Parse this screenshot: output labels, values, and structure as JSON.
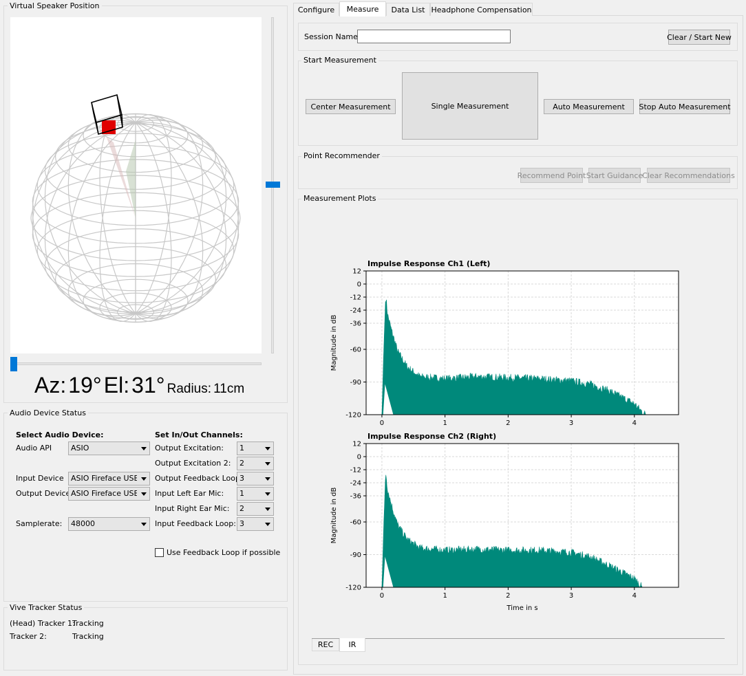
{
  "speaker": {
    "title": "Virtual Speaker Position",
    "az_label": "Az:",
    "az_value": "19°",
    "el_label": "El:",
    "el_value": "31°",
    "radius_label": "Radius:",
    "radius_value": "11cm"
  },
  "audio": {
    "title": "Audio Device Status",
    "select_heading": "Select Audio Device:",
    "channels_heading": "Set In/Out Channels:",
    "api_label": "Audio API",
    "api_value": "ASIO",
    "input_label": "Input Device",
    "input_value": "ASIO Fireface USB (",
    "output_label": "Output Device",
    "output_value": "ASIO Fireface USB (",
    "samplerate_label": "Samplerate:",
    "samplerate_value": "48000",
    "channels": [
      {
        "label": "Output Excitation:",
        "value": "1"
      },
      {
        "label": "Output Excitation 2:",
        "value": "2"
      },
      {
        "label": "Output Feedback Loop:",
        "value": "3"
      },
      {
        "label": "Input Left Ear Mic:",
        "value": "1"
      },
      {
        "label": "Input Right Ear Mic:",
        "value": "2"
      },
      {
        "label": "Input Feedback Loop:",
        "value": "3"
      }
    ],
    "feedback_checkbox": "Use Feedback Loop if possible"
  },
  "vive": {
    "title": "Vive Tracker Status",
    "tracker1_label": "(Head) Tracker 1:",
    "tracker1_status": "Tracking",
    "tracker2_label": "Tracker 2:",
    "tracker2_status": "Tracking"
  },
  "tabs": [
    "Configure",
    "Measure",
    "Data List",
    "Headphone Compensation"
  ],
  "active_tab": "Measure",
  "session": {
    "label": "Session Name:",
    "value": "",
    "clear_button": "Clear / Start New"
  },
  "start_measurement": {
    "title": "Start Measurement",
    "center": "Center Measurement",
    "single": "Single Measurement",
    "auto": "Auto Measurement",
    "stop": "Stop Auto Measurement"
  },
  "recommender": {
    "title": "Point Recommender",
    "recommend": "Recommend Point",
    "guidance": "Start Guidance",
    "clear": "Clear Recommendations"
  },
  "plots": {
    "title": "Measurement Plots",
    "bottom_tabs": [
      "REC",
      "IR"
    ],
    "active_bottom_tab": "IR"
  },
  "colors": {
    "trace": "#00897b",
    "speaker": "#e00000",
    "slider": "#0078d7"
  },
  "chart_data": [
    {
      "type": "area",
      "title": "Impulse Response Ch1 (Left)",
      "xlabel": "",
      "ylabel": "Magnitude in dB",
      "xlim": [
        -0.25,
        4.7
      ],
      "ylim": [
        -120,
        12
      ],
      "xticks": [
        0,
        1,
        2,
        3,
        4
      ],
      "yticks": [
        12,
        0,
        -12,
        -24,
        -36,
        -60,
        -90,
        -120
      ],
      "grid": true,
      "envelope": {
        "x": [
          0,
          0.03,
          0.06,
          0.09,
          0.15,
          0.25,
          0.4,
          0.6,
          1.0,
          1.5,
          2.0,
          2.5,
          3.0,
          3.3,
          3.6,
          3.8,
          4.0,
          4.1,
          4.18
        ],
        "y": [
          -120,
          -60,
          -10,
          -28,
          -42,
          -62,
          -76,
          -85,
          -87,
          -85,
          -86,
          -87,
          -89,
          -92,
          -98,
          -104,
          -110,
          -116,
          -120
        ]
      }
    },
    {
      "type": "area",
      "title": "Impulse Response Ch2 (Right)",
      "xlabel": "Time in s",
      "ylabel": "Magnitude in dB",
      "xlim": [
        -0.25,
        4.7
      ],
      "ylim": [
        -120,
        12
      ],
      "xticks": [
        0,
        1,
        2,
        3,
        4
      ],
      "yticks": [
        12,
        0,
        -12,
        -24,
        -36,
        -60,
        -90,
        -120
      ],
      "grid": true,
      "envelope": {
        "x": [
          0,
          0.03,
          0.06,
          0.09,
          0.15,
          0.25,
          0.4,
          0.6,
          1.0,
          1.5,
          2.0,
          2.5,
          3.0,
          3.3,
          3.6,
          3.8,
          4.0,
          4.08,
          4.12
        ],
        "y": [
          -120,
          -62,
          -14,
          -30,
          -44,
          -63,
          -76,
          -84,
          -86,
          -85,
          -86,
          -86,
          -88,
          -92,
          -100,
          -106,
          -112,
          -117,
          -120
        ]
      }
    }
  ]
}
